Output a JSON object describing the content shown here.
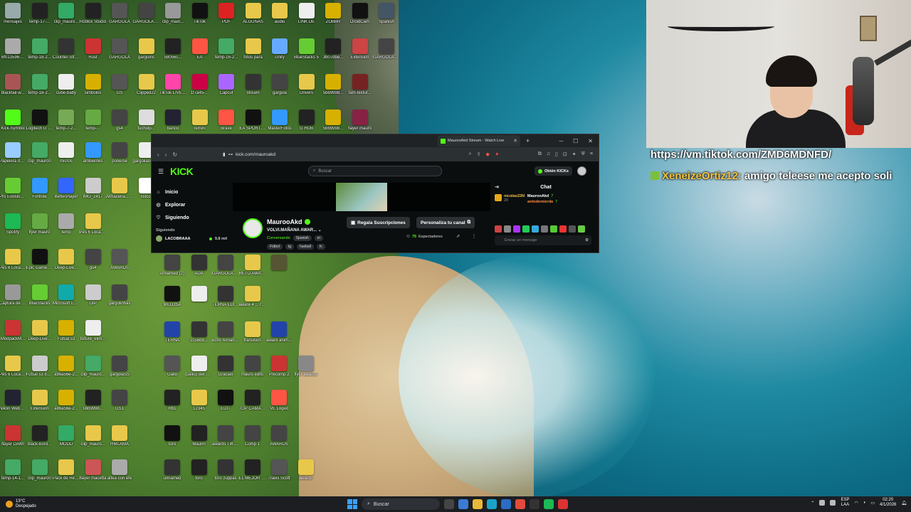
{
  "colors": {
    "kick_green": "#53fc18",
    "browser_bg": "#0b0e0f",
    "taskbar": "#1c1e22"
  },
  "desktop": {
    "icons": [
      {
        "label": "mensajes",
        "color": "#9aa"
      },
      {
        "label": "temp-17-...",
        "color": "#222"
      },
      {
        "label": "clip_mauro...",
        "color": "#3a6"
      },
      {
        "label": "Roblox Studio",
        "color": "#222"
      },
      {
        "label": "GARGOLA",
        "color": "#555"
      },
      {
        "label": "GARGOLAS AWARDS",
        "color": "#444"
      },
      {
        "label": "clip_main...",
        "color": "#999"
      },
      {
        "label": "TikTok",
        "color": "#111"
      },
      {
        "label": "PDF",
        "color": "#d22"
      },
      {
        "label": "ALGUNAS",
        "color": "#e8c84a"
      },
      {
        "label": "audio",
        "color": "#e8c84a"
      },
      {
        "label": "LINK DE",
        "color": "#eee"
      },
      {
        "label": "ZOBBR",
        "color": "#d8b000"
      },
      {
        "label": "DroidCam",
        "color": "#111"
      },
      {
        "label": "Spanish",
        "color": "#456"
      },
      {
        "label": "6f013596-...",
        "color": "#aaa"
      },
      {
        "label": "temp-18-2...",
        "color": "#4a6"
      },
      {
        "label": "Counter-Strike",
        "color": "#333"
      },
      {
        "label": "Rust",
        "color": "#c33"
      },
      {
        "label": "GARGOLA",
        "color": "#555"
      },
      {
        "label": "gargoins",
        "color": "#e8c84a"
      },
      {
        "label": "58056c...",
        "color": "#222"
      },
      {
        "label": "EA",
        "color": "#f54"
      },
      {
        "label": "temp-16-2...",
        "color": "#4a6"
      },
      {
        "label": "fotos para",
        "color": "#e8c84a"
      },
      {
        "label": "Unity",
        "color": "#6af"
      },
      {
        "label": "BlueStacks 5",
        "color": "#6c3"
      },
      {
        "label": "3b07dbe...",
        "color": "#222"
      },
      {
        "label": "Extension",
        "color": "#c44"
      },
      {
        "label": "GARGOLAS AWARDS",
        "color": "#444"
      },
      {
        "label": "blacktail-w...",
        "color": "#a55"
      },
      {
        "label": "temp-18-2...",
        "color": "#4a6"
      },
      {
        "label": "cube-baby",
        "color": "#eee"
      },
      {
        "label": "simbolos",
        "color": "#d8b000"
      },
      {
        "label": "GS",
        "color": "#555"
      },
      {
        "label": "Clipped22",
        "color": "#e8c84a"
      },
      {
        "label": "TikTok LIVE Studio",
        "color": "#f4a"
      },
      {
        "label": "1f7a45-...",
        "color": "#c04"
      },
      {
        "label": "Capcut",
        "color": "#a6f"
      },
      {
        "label": "stream",
        "color": "#333"
      },
      {
        "label": "gargola",
        "color": "#444"
      },
      {
        "label": "Drivers",
        "color": "#e8c84a"
      },
      {
        "label": "5bb9998...",
        "color": "#d8b000"
      },
      {
        "label": "fam-textur...",
        "color": "#722"
      },
      {
        "label": "Kick-Symbol",
        "color": "#53fc18"
      },
      {
        "label": "Logitech G HUB",
        "color": "#111"
      },
      {
        "label": "temp-7-2...",
        "color": "#7a5"
      },
      {
        "label": "temp-...",
        "color": "#6a4"
      },
      {
        "label": "gs4",
        "color": "#444"
      },
      {
        "label": "tucholp...",
        "color": "#ddd"
      },
      {
        "label": "banco",
        "color": "#223"
      },
      {
        "label": "remini",
        "color": "#e8c84a"
      },
      {
        "label": "Brave",
        "color": "#f54"
      },
      {
        "label": "EA SPORTS FC",
        "color": "#111"
      },
      {
        "label": "MasterFotos",
        "color": "#39f"
      },
      {
        "label": "G HUB",
        "color": "#222"
      },
      {
        "label": "5bb9998...",
        "color": "#d8b000"
      },
      {
        "label": "flayer mauro",
        "color": "#824"
      }
    ],
    "desktop_lower": [
      {
        "label": "Papelera de reciclaje",
        "color": "#9cf"
      },
      {
        "label": "clip_mauro0",
        "color": "#4a6"
      },
      {
        "label": "micros",
        "color": "#eee"
      },
      {
        "label": "ambientes",
        "color": "#39f"
      },
      {
        "label": "ponerse",
        "color": "#444"
      },
      {
        "label": "gargoliass awards",
        "color": "#eee"
      },
      {
        "label": "Pro Evolution Soccer 2017",
        "color": "#6c3"
      },
      {
        "label": "Fortnite",
        "color": "#39f"
      },
      {
        "label": "BetterPlayer",
        "color": "#36f"
      },
      {
        "label": "IMG_2417",
        "color": "#ccc"
      },
      {
        "label": "Almacena... automatic...",
        "color": "#e8c84a"
      },
      {
        "label": "listcol",
        "color": "#fff"
      },
      {
        "label": "Spotify",
        "color": "#1db954"
      },
      {
        "label": "flyer mauro",
        "color": "#6a4"
      },
      {
        "label": "temp",
        "color": "#aaa"
      },
      {
        "label": "Pes 6 Locazos",
        "color": "#e8c84a"
      },
      {
        "label": "Pes 6 Locazos",
        "color": "#e8c84a"
      },
      {
        "label": "Epic Games Launcher",
        "color": "#111"
      },
      {
        "label": "Deep-Live...",
        "color": "#e8c84a"
      },
      {
        "label": "gs4",
        "color": "#444"
      },
      {
        "label": "AWARDS",
        "color": "#555"
      },
      {
        "label": "Captura de pantalla",
        "color": "#999"
      },
      {
        "label": "BlueStacks",
        "color": "#6c3"
      },
      {
        "label": "Microsoft Edge",
        "color": "#1aa"
      },
      {
        "label": "OIP",
        "color": "#ccc"
      },
      {
        "label": "gargolinhas",
        "color": "#444"
      },
      {
        "label": "ModpackM...",
        "color": "#c33"
      },
      {
        "label": "Deep-Live...",
        "color": "#e8c84a"
      },
      {
        "label": "Futsal s3",
        "color": "#d8b000"
      },
      {
        "label": "fixture_elim...",
        "color": "#eee"
      },
      {
        "label": "Pes 6 Locazos",
        "color": "#e8c84a"
      },
      {
        "label": "Futsal s3 by Batinga",
        "color": "#ccc"
      },
      {
        "label": "a86a56e-2...",
        "color": "#d8b000"
      },
      {
        "label": "clip_mauro...",
        "color": "#4a6"
      },
      {
        "label": "gargolaSS",
        "color": "#444"
      },
      {
        "label": "Nikon WebCam",
        "color": "#223"
      },
      {
        "label": "Extension",
        "color": "#e8c84a"
      },
      {
        "label": "a86a56e-2...",
        "color": "#d8b000"
      },
      {
        "label": "5bb9998...",
        "color": "#222"
      },
      {
        "label": "GS1",
        "color": "#444"
      },
      {
        "label": "flayer DAWI",
        "color": "#c33"
      },
      {
        "label": "black-bord...",
        "color": "#222"
      },
      {
        "label": "MODD",
        "color": "#3a6"
      },
      {
        "label": "clip_mauro...",
        "color": "#e8c84a"
      },
      {
        "label": "HMLAMA",
        "color": "#e8c84a"
      },
      {
        "label": "temp-14-1...",
        "color": "#4a6"
      },
      {
        "label": "clip_mauro0",
        "color": "#4a6"
      },
      {
        "label": "Pack de Recursos",
        "color": "#e8c84a"
      },
      {
        "label": "flayer macetta",
        "color": "#c55"
      },
      {
        "label": "altea con efe",
        "color": "#aaa"
      },
      {
        "label": "temp-14-1...",
        "color": "#4a6"
      },
      {
        "label": "clip_mauro2",
        "color": "#4a6"
      },
      {
        "label": "pelicula",
        "color": "#4a6"
      },
      {
        "label": "gargola",
        "color": "#444"
      },
      {
        "label": "gargolas awards",
        "color": "#444"
      }
    ],
    "desktop_mid": [
      {
        "label": "unnamed (2)",
        "color": "#444"
      },
      {
        "label": "ADA",
        "color": "#333"
      },
      {
        "label": "GARGOLAS AWARDS",
        "color": "#444"
      },
      {
        "label": "RETO AWARDS",
        "color": "#e8c84a"
      },
      {
        "label": "",
        "color": "#553"
      },
      {
        "label": "MELOSA",
        "color": "#111"
      },
      {
        "label": "",
        "color": "#eee"
      },
      {
        "label": "TERNA EDITORIAL",
        "color": "#333"
      },
      {
        "label": "aware 4 ... river",
        "color": "#e8c84a"
      },
      {
        "label": "TERNA",
        "color": "#24a"
      },
      {
        "label": "2c58d8...",
        "color": "#333"
      },
      {
        "label": "echo fernando",
        "color": "#444"
      },
      {
        "label": "transition",
        "color": "#e8c84a"
      },
      {
        "label": "award anim...",
        "color": "#24a"
      },
      {
        "label": "Gallo",
        "color": "#555"
      },
      {
        "label": "Galico del Mundial",
        "color": "#eee"
      },
      {
        "label": "Gracias",
        "color": "#333"
      },
      {
        "label": "mauro edits",
        "color": "#444"
      },
      {
        "label": "Precomp 2",
        "color": "#c33"
      },
      {
        "label": "flyer awards",
        "color": "#888"
      },
      {
        "label": "Rb1",
        "color": "#222"
      },
      {
        "label": "12345",
        "color": "#e8c84a"
      },
      {
        "label": "EDIT",
        "color": "#111"
      },
      {
        "label": "TOP CAMADOR",
        "color": "#222"
      },
      {
        "label": "VE Logeo",
        "color": "#f54"
      },
      {
        "label": "toro",
        "color": "#111"
      },
      {
        "label": "Maurin",
        "color": "#222"
      },
      {
        "label": "awards TIKTOK",
        "color": "#444"
      },
      {
        "label": "Comp 1",
        "color": "#444"
      },
      {
        "label": "AWARDS",
        "color": "#444"
      },
      {
        "label": "unnamed",
        "color": "#333"
      },
      {
        "label": "toro",
        "color": "#222"
      },
      {
        "label": "toro zuppas",
        "color": "#333"
      },
      {
        "label": "EL MEJOR PHONE",
        "color": "#222"
      },
      {
        "label": "Travis Scott",
        "color": "#555"
      },
      {
        "label": "awards",
        "color": "#e8c84a"
      }
    ]
  },
  "webcam_overlay": {
    "link_text": "https://vm.tiktok.com/ZMD6MDNFD/",
    "message_user": "XeneizeOrtiz12:",
    "message_text": "amigo teleese me acepto soli"
  },
  "browser": {
    "tab_title": "MaurooAkd Stream - Watch Live",
    "url": "kick.com/mauroakd",
    "logo_text": "KICK",
    "search_placeholder": "Buscar",
    "get_kicks_label": "Obtén KICKs",
    "sidebar": {
      "items": [
        {
          "label": "Inicio",
          "icon": "home-icon"
        },
        {
          "label": "Explorar",
          "icon": "compass-icon"
        },
        {
          "label": "Siguiendo",
          "icon": "heart-icon"
        }
      ],
      "following_header": "Siguiendo",
      "following_channel": "LACOBRAAA",
      "following_viewers": "9,8 mil"
    },
    "stream": {
      "streamer": "MaurooAkd",
      "title": "VOLVI.MAÑANA AWAR...",
      "category": "Conversando",
      "language": "Spanish",
      "flag": "el",
      "tags": [
        "Fútbol",
        "tg",
        "haxball",
        "fc"
      ],
      "subscribe_gift_label": "Regala Suscripciones",
      "customize_label": "Personaliza tu canal",
      "viewers_count": "75",
      "viewers_label": "Espectadores"
    },
    "chat": {
      "header": "Chat",
      "top_gifter": "nicolas23N",
      "top_gifter_count": "20",
      "top_users": [
        {
          "name": "MaurooAkd",
          "count": "7"
        },
        {
          "name": "antodemierda",
          "count": "7"
        }
      ],
      "input_placeholder": "Enviar un mensaje"
    }
  },
  "taskbar": {
    "weather_temp": "13°C",
    "weather_desc": "Despejado",
    "search_label": "Buscar",
    "lang_top": "ESP",
    "lang_bottom": "LAA",
    "time": "02:20",
    "date": "4/1/2026"
  }
}
